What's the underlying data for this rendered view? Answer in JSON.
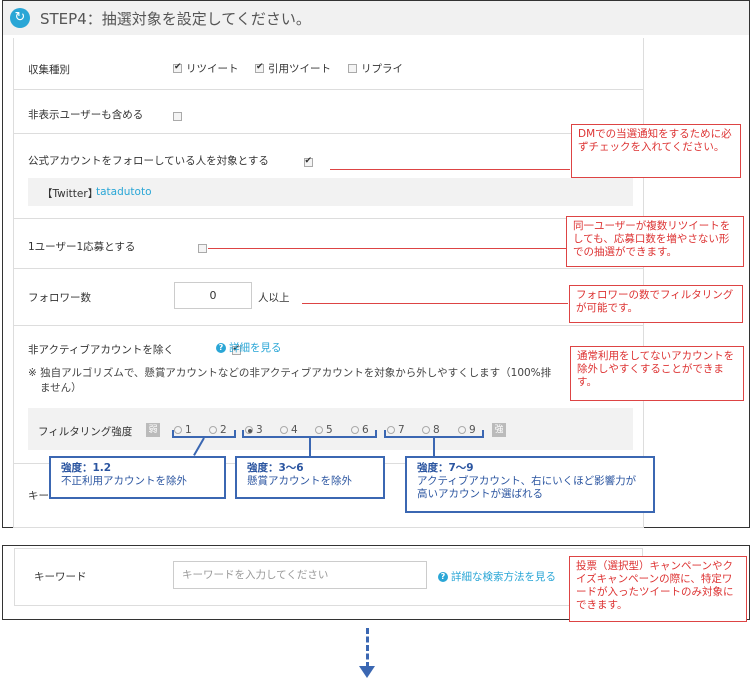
{
  "step": {
    "icon": "refresh-icon",
    "title": "STEP4：抽選対象を設定してください。"
  },
  "collect": {
    "label": "収集種別",
    "options": [
      {
        "label": "リツイート",
        "checked": true
      },
      {
        "label": "引用ツイート",
        "checked": true
      },
      {
        "label": "リプライ",
        "checked": false
      }
    ]
  },
  "hidden_users": {
    "label": "非表示ユーザーも含める",
    "checked": false
  },
  "follow_official": {
    "label": "公式アカウントをフォローしている人を対象とする",
    "checked": true,
    "account_prefix": "【Twitter】",
    "account_name": "tatadutoto"
  },
  "one_per_user": {
    "label": "1ユーザー1応募とする",
    "checked": false
  },
  "followers": {
    "label": "フォロワー数",
    "value": "0",
    "suffix": "人以上"
  },
  "inactive": {
    "label": "非アクティブアカウントを除く",
    "checked": true,
    "detail_link": "詳細を見る",
    "note": "※ 独自アルゴリズムで、懸賞アカウントなどの非アクティブアカウントを対象から外しやすくします（100%排",
    "note2": "ません）"
  },
  "filter": {
    "label": "フィルタリング強度",
    "weak": "弱",
    "strong": "強",
    "levels": [
      "1",
      "2",
      "3",
      "4",
      "5",
      "6",
      "7",
      "8",
      "9"
    ],
    "selected": "3"
  },
  "keyword_hidden": {
    "label": "キー"
  },
  "keyword": {
    "label": "キーワード",
    "placeholder": "キーワードを入力してください",
    "detail_link": "詳細な検索方法を見る"
  },
  "callouts": {
    "dm": "DMでの当選通知をするために必ずチェックを入れてください。",
    "one": "同一ユーザーが複数リツイートをしても、応募口数を増やさない形での抽選ができます。",
    "followers": "フォロワーの数でフィルタリングが可能です。",
    "inactive": "通常利用をしてないアカウントを除外しやすくすることができます。",
    "keyword": "投票（選択型）キャンペーンやクイズキャンペーンの際に、特定ワードが入ったツイートのみ対象にできます。"
  },
  "levels": [
    {
      "title": "強度：1.2",
      "desc": "不正利用アカウントを除外"
    },
    {
      "title": "強度：3〜6",
      "desc": "懸賞アカウントを除外"
    },
    {
      "title": "強度：7〜9",
      "desc": "アクティブアカウント、右にいくほど影響力が高いアカウントが選ばれる"
    }
  ],
  "colors": {
    "accent": "#2aa6d6",
    "callout_red": "#dd4444",
    "callout_blue": "#3b67b2"
  }
}
